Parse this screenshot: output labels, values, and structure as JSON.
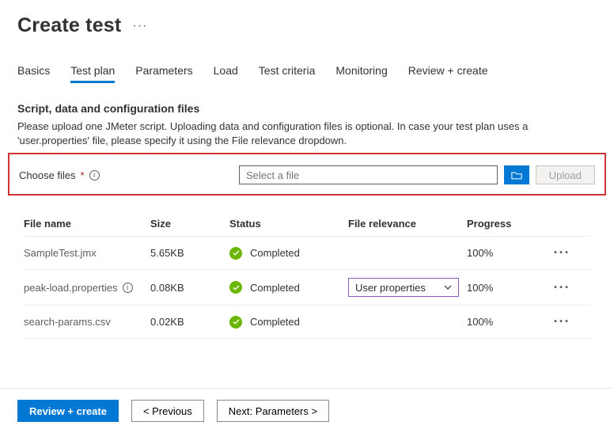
{
  "header": {
    "title": "Create test"
  },
  "tabs": [
    {
      "id": "basics",
      "label": "Basics"
    },
    {
      "id": "testplan",
      "label": "Test plan",
      "active": true
    },
    {
      "id": "params",
      "label": "Parameters"
    },
    {
      "id": "load",
      "label": "Load"
    },
    {
      "id": "criteria",
      "label": "Test criteria"
    },
    {
      "id": "monitor",
      "label": "Monitoring"
    },
    {
      "id": "review",
      "label": "Review + create"
    }
  ],
  "section": {
    "title": "Script, data and configuration files",
    "description": "Please upload one JMeter script. Uploading data and configuration files is optional. In case your test plan uses a 'user.properties' file, please specify it using the File relevance dropdown."
  },
  "chooseFiles": {
    "label": "Choose files",
    "placeholder": "Select a file",
    "uploadLabel": "Upload"
  },
  "table": {
    "headers": {
      "name": "File name",
      "size": "Size",
      "status": "Status",
      "relevance": "File relevance",
      "progress": "Progress"
    },
    "rows": [
      {
        "name": "SampleTest.jmx",
        "size": "5.65KB",
        "status": "Completed",
        "relevance": "",
        "progress": "100%"
      },
      {
        "name": "peak-load.properties",
        "size": "0.08KB",
        "status": "Completed",
        "relevance": "User properties",
        "progress": "100%",
        "hasInfo": true
      },
      {
        "name": "search-params.csv",
        "size": "0.02KB",
        "status": "Completed",
        "relevance": "",
        "progress": "100%"
      }
    ]
  },
  "footer": {
    "review": "Review + create",
    "previous": "< Previous",
    "next": "Next: Parameters >"
  }
}
